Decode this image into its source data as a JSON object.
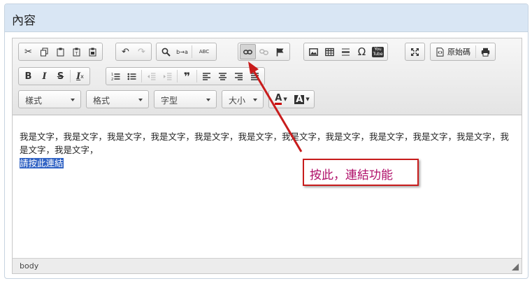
{
  "panel": {
    "title": "內容"
  },
  "toolbar": {
    "source_label": "原始碼",
    "style_combo": "樣式",
    "format_combo": "格式",
    "font_combo": "字型",
    "size_combo": "大小",
    "text_color_glyph": "A",
    "bg_color_glyph": "A",
    "bold": "B",
    "italic": "I",
    "strike": "S",
    "remove_format": "I",
    "quote": "❞",
    "omega": "Ω",
    "youtube_line1": "You",
    "youtube_line2": "Tube",
    "replace_glyph": "b→a",
    "spell_glyph": "ABC"
  },
  "content": {
    "text": "我是文字，我是文字，我是文字，我是文字，我是文字，我是文字，我是文字，我是文字，我是文字，我是文字，我是文字，我是文字，我是文字，",
    "link_text": "請按此連結"
  },
  "statusbar": {
    "path": "body"
  },
  "annotation": {
    "text": "按此，連結功能"
  },
  "colors": {
    "annotation_border": "#c81c1c",
    "annotation_text": "#b0106a",
    "selection": "#3163c4",
    "heading_bg": "#d9e6f4"
  }
}
